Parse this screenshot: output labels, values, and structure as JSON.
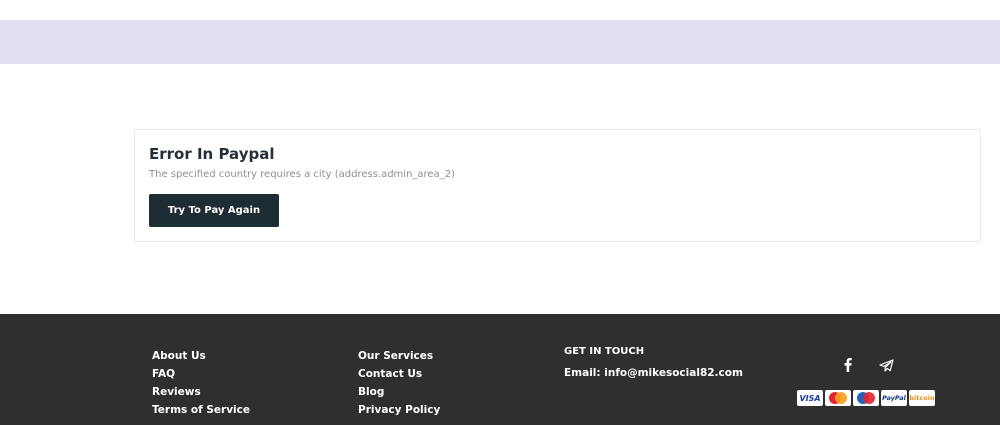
{
  "error": {
    "title": "Error In Paypal",
    "message": "The specified country requires a city (address.admin_area_2)",
    "retry_label": "Try To Pay Again"
  },
  "footer": {
    "col1": [
      "About Us",
      "FAQ",
      "Reviews",
      "Terms of Service"
    ],
    "col2": [
      "Our Services",
      "Contact Us",
      "Blog",
      "Privacy Policy"
    ],
    "contact": {
      "heading": "GET IN TOUCH",
      "email": "Email: info@mikesocial82.com"
    },
    "social_icons": [
      "facebook-icon",
      "telegram-icon"
    ],
    "payments": [
      {
        "name": "visa",
        "text": "VISA"
      },
      {
        "name": "mastercard",
        "text": "MasterCard"
      },
      {
        "name": "maestro",
        "text": "Maestro"
      },
      {
        "name": "paypal",
        "text": "PayPal"
      },
      {
        "name": "bitcoin",
        "text": "bitcoin"
      }
    ]
  },
  "colors": {
    "band": "#e2def3",
    "button": "#1e2c33",
    "footer": "#2f2f2f"
  }
}
